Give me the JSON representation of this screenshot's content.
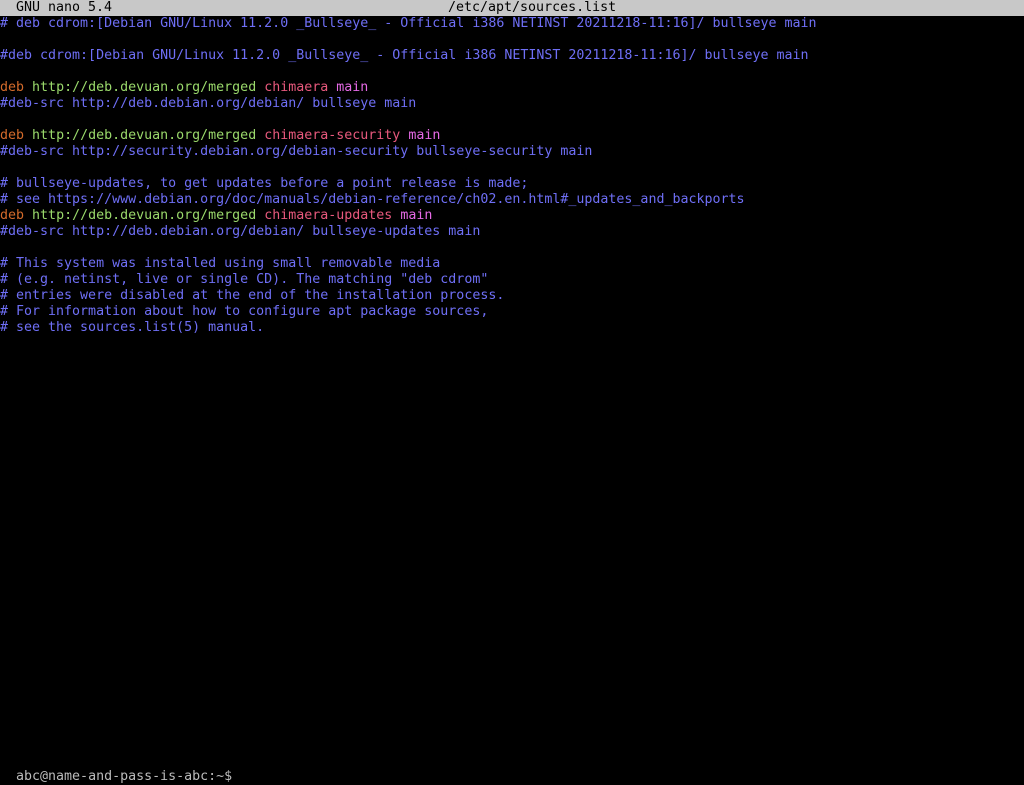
{
  "window": {
    "app_title": "GNU nano 5.4",
    "file_name": "/etc/apt/sources.list"
  },
  "colors": {
    "comment": "#6f6ff6",
    "deb": "#d46b2b",
    "url": "#9ad96b",
    "suite": "#e8597d",
    "component": "#e66ae6",
    "prompt": "#bbbbbb",
    "titlebar_bg": "#c8c8c8"
  },
  "lines": [
    [
      {
        "text": "# deb cdrom:[Debian GNU/Linux 11.2.0 _Bullseye_ - Official i386 NETINST 20211218-11:16]/ bullseye main",
        "kind": "comment"
      }
    ],
    [],
    [
      {
        "text": "#deb cdrom:[Debian GNU/Linux 11.2.0 _Bullseye_ - Official i386 NETINST 20211218-11:16]/ bullseye main",
        "kind": "comment"
      }
    ],
    [],
    [
      {
        "text": "deb",
        "kind": "deb"
      },
      {
        "text": " ",
        "kind": "plain"
      },
      {
        "text": "http://deb.devuan.org/merged",
        "kind": "url"
      },
      {
        "text": " ",
        "kind": "plain"
      },
      {
        "text": "chimaera",
        "kind": "suite"
      },
      {
        "text": " ",
        "kind": "plain"
      },
      {
        "text": "main",
        "kind": "component"
      }
    ],
    [
      {
        "text": "#deb-src http://deb.debian.org/debian/ bullseye main",
        "kind": "comment"
      }
    ],
    [],
    [
      {
        "text": "deb",
        "kind": "deb"
      },
      {
        "text": " ",
        "kind": "plain"
      },
      {
        "text": "http://deb.devuan.org/merged",
        "kind": "url"
      },
      {
        "text": " ",
        "kind": "plain"
      },
      {
        "text": "chimaera-security",
        "kind": "suite"
      },
      {
        "text": " ",
        "kind": "plain"
      },
      {
        "text": "main",
        "kind": "component"
      }
    ],
    [
      {
        "text": "#deb-src http://security.debian.org/debian-security bullseye-security main",
        "kind": "comment"
      }
    ],
    [],
    [
      {
        "text": "# bullseye-updates, to get updates before a point release is made;",
        "kind": "comment"
      }
    ],
    [
      {
        "text": "# see https://www.debian.org/doc/manuals/debian-reference/ch02.en.html#_updates_and_backports",
        "kind": "comment"
      }
    ],
    [
      {
        "text": "deb",
        "kind": "deb"
      },
      {
        "text": " ",
        "kind": "plain"
      },
      {
        "text": "http://deb.devuan.org/merged",
        "kind": "url"
      },
      {
        "text": " ",
        "kind": "plain"
      },
      {
        "text": "chimaera-updates",
        "kind": "suite"
      },
      {
        "text": " ",
        "kind": "plain"
      },
      {
        "text": "main",
        "kind": "component"
      }
    ],
    [
      {
        "text": "#deb-src http://deb.debian.org/debian/ bullseye-updates main",
        "kind": "comment"
      }
    ],
    [],
    [
      {
        "text": "# This system was installed using small removable media",
        "kind": "comment"
      }
    ],
    [
      {
        "text": "# (e.g. netinst, live or single CD). The matching \"deb cdrom\"",
        "kind": "comment"
      }
    ],
    [
      {
        "text": "# entries were disabled at the end of the installation process.",
        "kind": "comment"
      }
    ],
    [
      {
        "text": "# For information about how to configure apt package sources,",
        "kind": "comment"
      }
    ],
    [
      {
        "text": "# see the sources.list(5) manual.",
        "kind": "comment"
      }
    ]
  ],
  "shell": {
    "prompt": "abc@name-and-pass-is-abc:~$"
  }
}
